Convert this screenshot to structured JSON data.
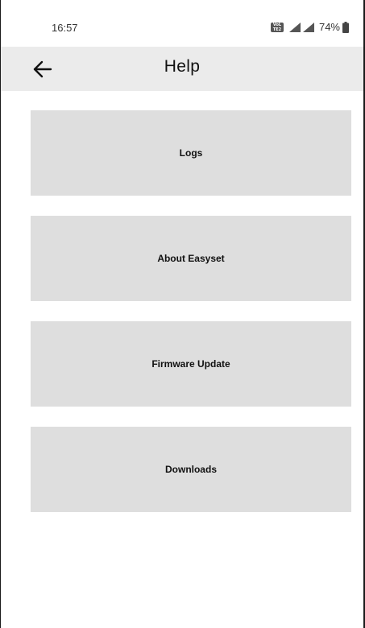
{
  "status_bar": {
    "time": "16:57",
    "volte_label": "VoLTE2",
    "battery_percent": "74%",
    "icons": [
      "volte-icon",
      "signal-icon",
      "signal-icon",
      "battery-icon"
    ]
  },
  "app_bar": {
    "back_icon": "arrow-left-icon",
    "title": "Help",
    "background": "#ebebeb"
  },
  "menu": {
    "item_background": "#dedede",
    "items": [
      {
        "label": "Logs"
      },
      {
        "label": "About Easyset"
      },
      {
        "label": "Firmware Update"
      },
      {
        "label": "Downloads"
      }
    ]
  }
}
